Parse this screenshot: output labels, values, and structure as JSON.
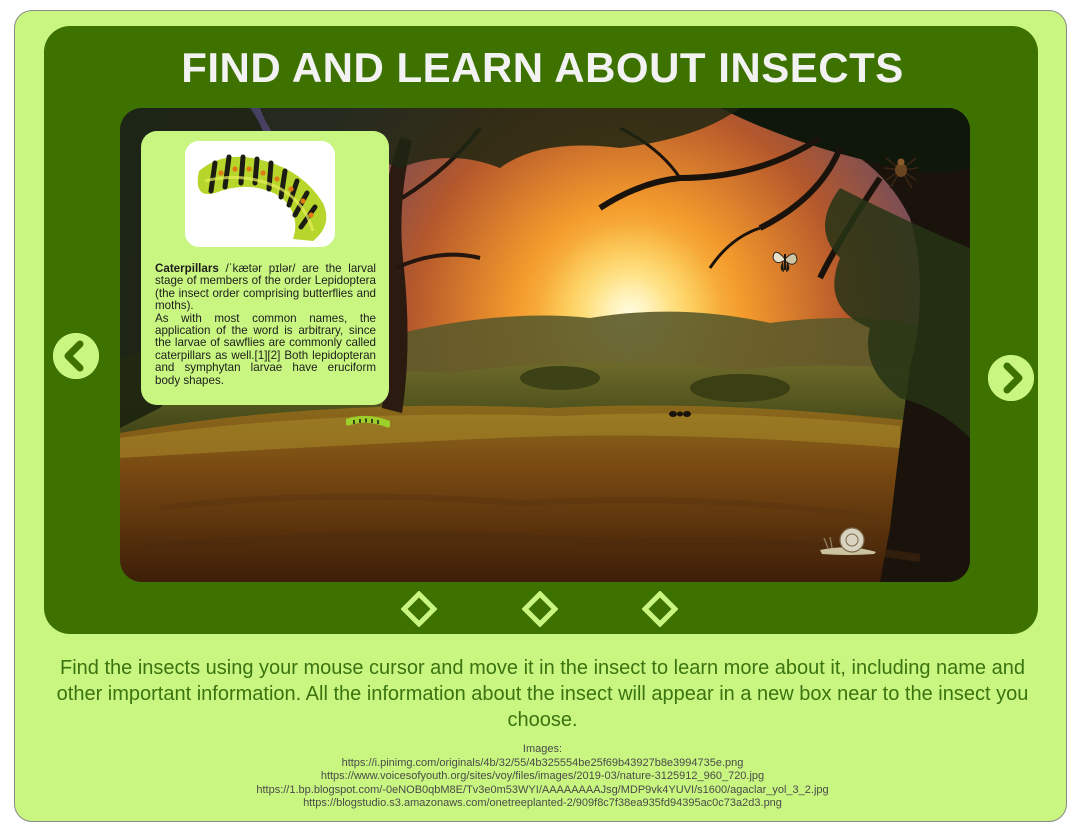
{
  "header": {
    "title": "FIND AND LEARN ABOUT INSECTS"
  },
  "info_card": {
    "name": "Caterpillars",
    "pronunciation": "/ˈkætər pɪlər/",
    "paragraph1_rest": "are the larval stage of members of the order Lepidoptera (the insect order comprising butterflies and moths).",
    "paragraph2": "As with most common names, the application of the word is arbitrary, since the larvae of sawflies are commonly called caterpillars as well.[1][2] Both lepidopteran and symphytan larvae have eruciform body shapes."
  },
  "navigation": {
    "prev_icon": "chevron-left-circle-icon",
    "next_icon": "chevron-right-circle-icon",
    "dots": [
      "diamond-icon",
      "diamond-icon",
      "diamond-icon"
    ]
  },
  "instructions": "Find the insects using your mouse cursor and move it in the insect to learn more about it, including name and other important information. All the information about the insect will appear in a new box near to the insect you choose.",
  "credits": {
    "label": "Images:",
    "urls": [
      "https://i.pinimg.com/originals/4b/32/55/4b325554be25f69b43927b8e3994735e.png",
      "https://www.voicesofyouth.org/sites/voy/files/images/2019-03/nature-3125912_960_720.jpg",
      "https://1.bp.blogspot.com/-0eNOB0qbM8E/Tv3e0m53WYI/AAAAAAAAJsg/MDP9vk4YUVI/s1600/agaclar_yol_3_2.jpg",
      "https://blogstudio.s3.amazonaws.com/onetreeplanted-2/909f8c7f38ea935fd94395ac0c73a2d3.png"
    ]
  },
  "colors": {
    "page_bg": "#c9f681",
    "panel_bg": "#3d7200",
    "title_text": "#f2f2f2",
    "instructions_text": "#3a7310"
  }
}
